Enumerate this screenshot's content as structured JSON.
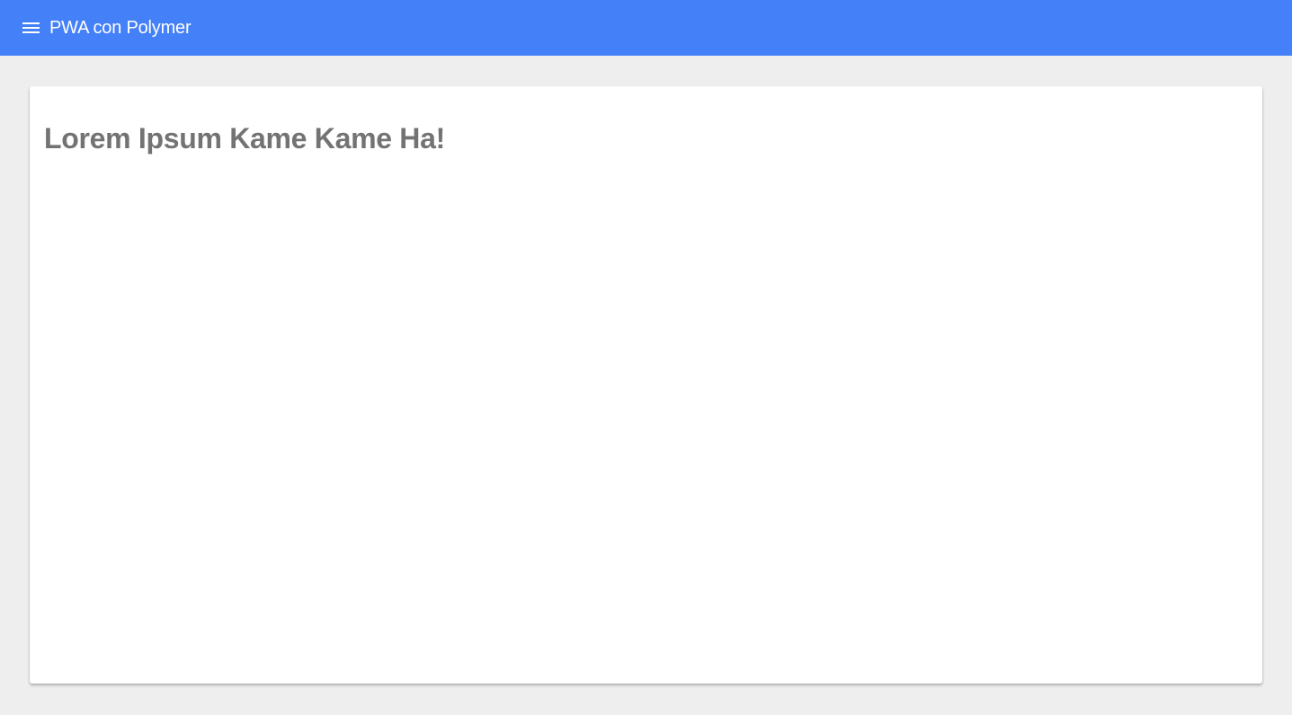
{
  "header": {
    "title": "PWA con Polymer",
    "menu_icon": "hamburger-menu-icon",
    "background_color": "#4480f8"
  },
  "main": {
    "card": {
      "heading": "Lorem Ipsum Kame Kame Ha!"
    },
    "background_color": "#eeeeee"
  }
}
